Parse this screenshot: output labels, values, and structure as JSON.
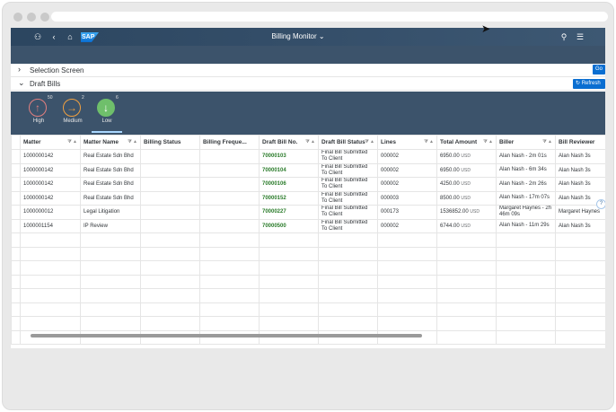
{
  "shell": {
    "app_title": "Billing Monitor",
    "logo_text": "SAP"
  },
  "sections": {
    "selection_screen": "Selection Screen",
    "draft_bills": "Draft Bills",
    "go_label": "Go",
    "refresh_label": "Refresh"
  },
  "filters": [
    {
      "label": "High",
      "count": "50",
      "arrow": "↑"
    },
    {
      "label": "Medium",
      "count": "2",
      "arrow": "→"
    },
    {
      "label": "Low",
      "count": "6",
      "arrow": "↓"
    }
  ],
  "table": {
    "headers": [
      "Matter",
      "Matter Name",
      "Billing Status",
      "Billing Freque...",
      "Draft Bill No.",
      "Draft Bill Status",
      "Lines",
      "Total Amount",
      "Biller",
      "Bill Reviewer"
    ],
    "rows": [
      [
        "1000000142",
        "Real Estate Sdn Bhd",
        "",
        "",
        "70000103",
        "Final Bill Submitted To Client",
        "000002",
        "6950.00",
        "USD",
        "Alan Nash - 2m 01s",
        "Alan Nash 3s"
      ],
      [
        "1000000142",
        "Real Estate Sdn Bhd",
        "",
        "",
        "70000104",
        "Final Bill Submitted To Client",
        "000002",
        "6950.00",
        "USD",
        "Alan Nash - 6m 34s",
        "Alan Nash 3s"
      ],
      [
        "1000000142",
        "Real Estate Sdn Bhd",
        "",
        "",
        "70000106",
        "Final Bill Submitted To Client",
        "000002",
        "4250.00",
        "USD",
        "Alan Nash - 2m 26s",
        "Alan Nash 3s"
      ],
      [
        "1000000142",
        "Real Estate Sdn Bhd",
        "",
        "",
        "70000152",
        "Final Bill Submitted To Client",
        "000003",
        "8500.00",
        "USD",
        "Alan Nash - 17m 07s",
        "Alan Nash 3s"
      ],
      [
        "1000000012",
        "Legal Litigation",
        "",
        "",
        "70000227",
        "Final Bill Submitted To Client",
        "000173",
        "1536852.00",
        "USD",
        "Margaret Haynes - 2h 46m 09s",
        "Margaret Haynes"
      ],
      [
        "1000001154",
        "IP Review",
        "",
        "",
        "70000500",
        "Final Bill Submitted To Client",
        "000002",
        "6744.00",
        "USD",
        "Alan Nash - 11m 29s",
        "Alan Nash 3s"
      ]
    ],
    "empty_rows": 8
  }
}
